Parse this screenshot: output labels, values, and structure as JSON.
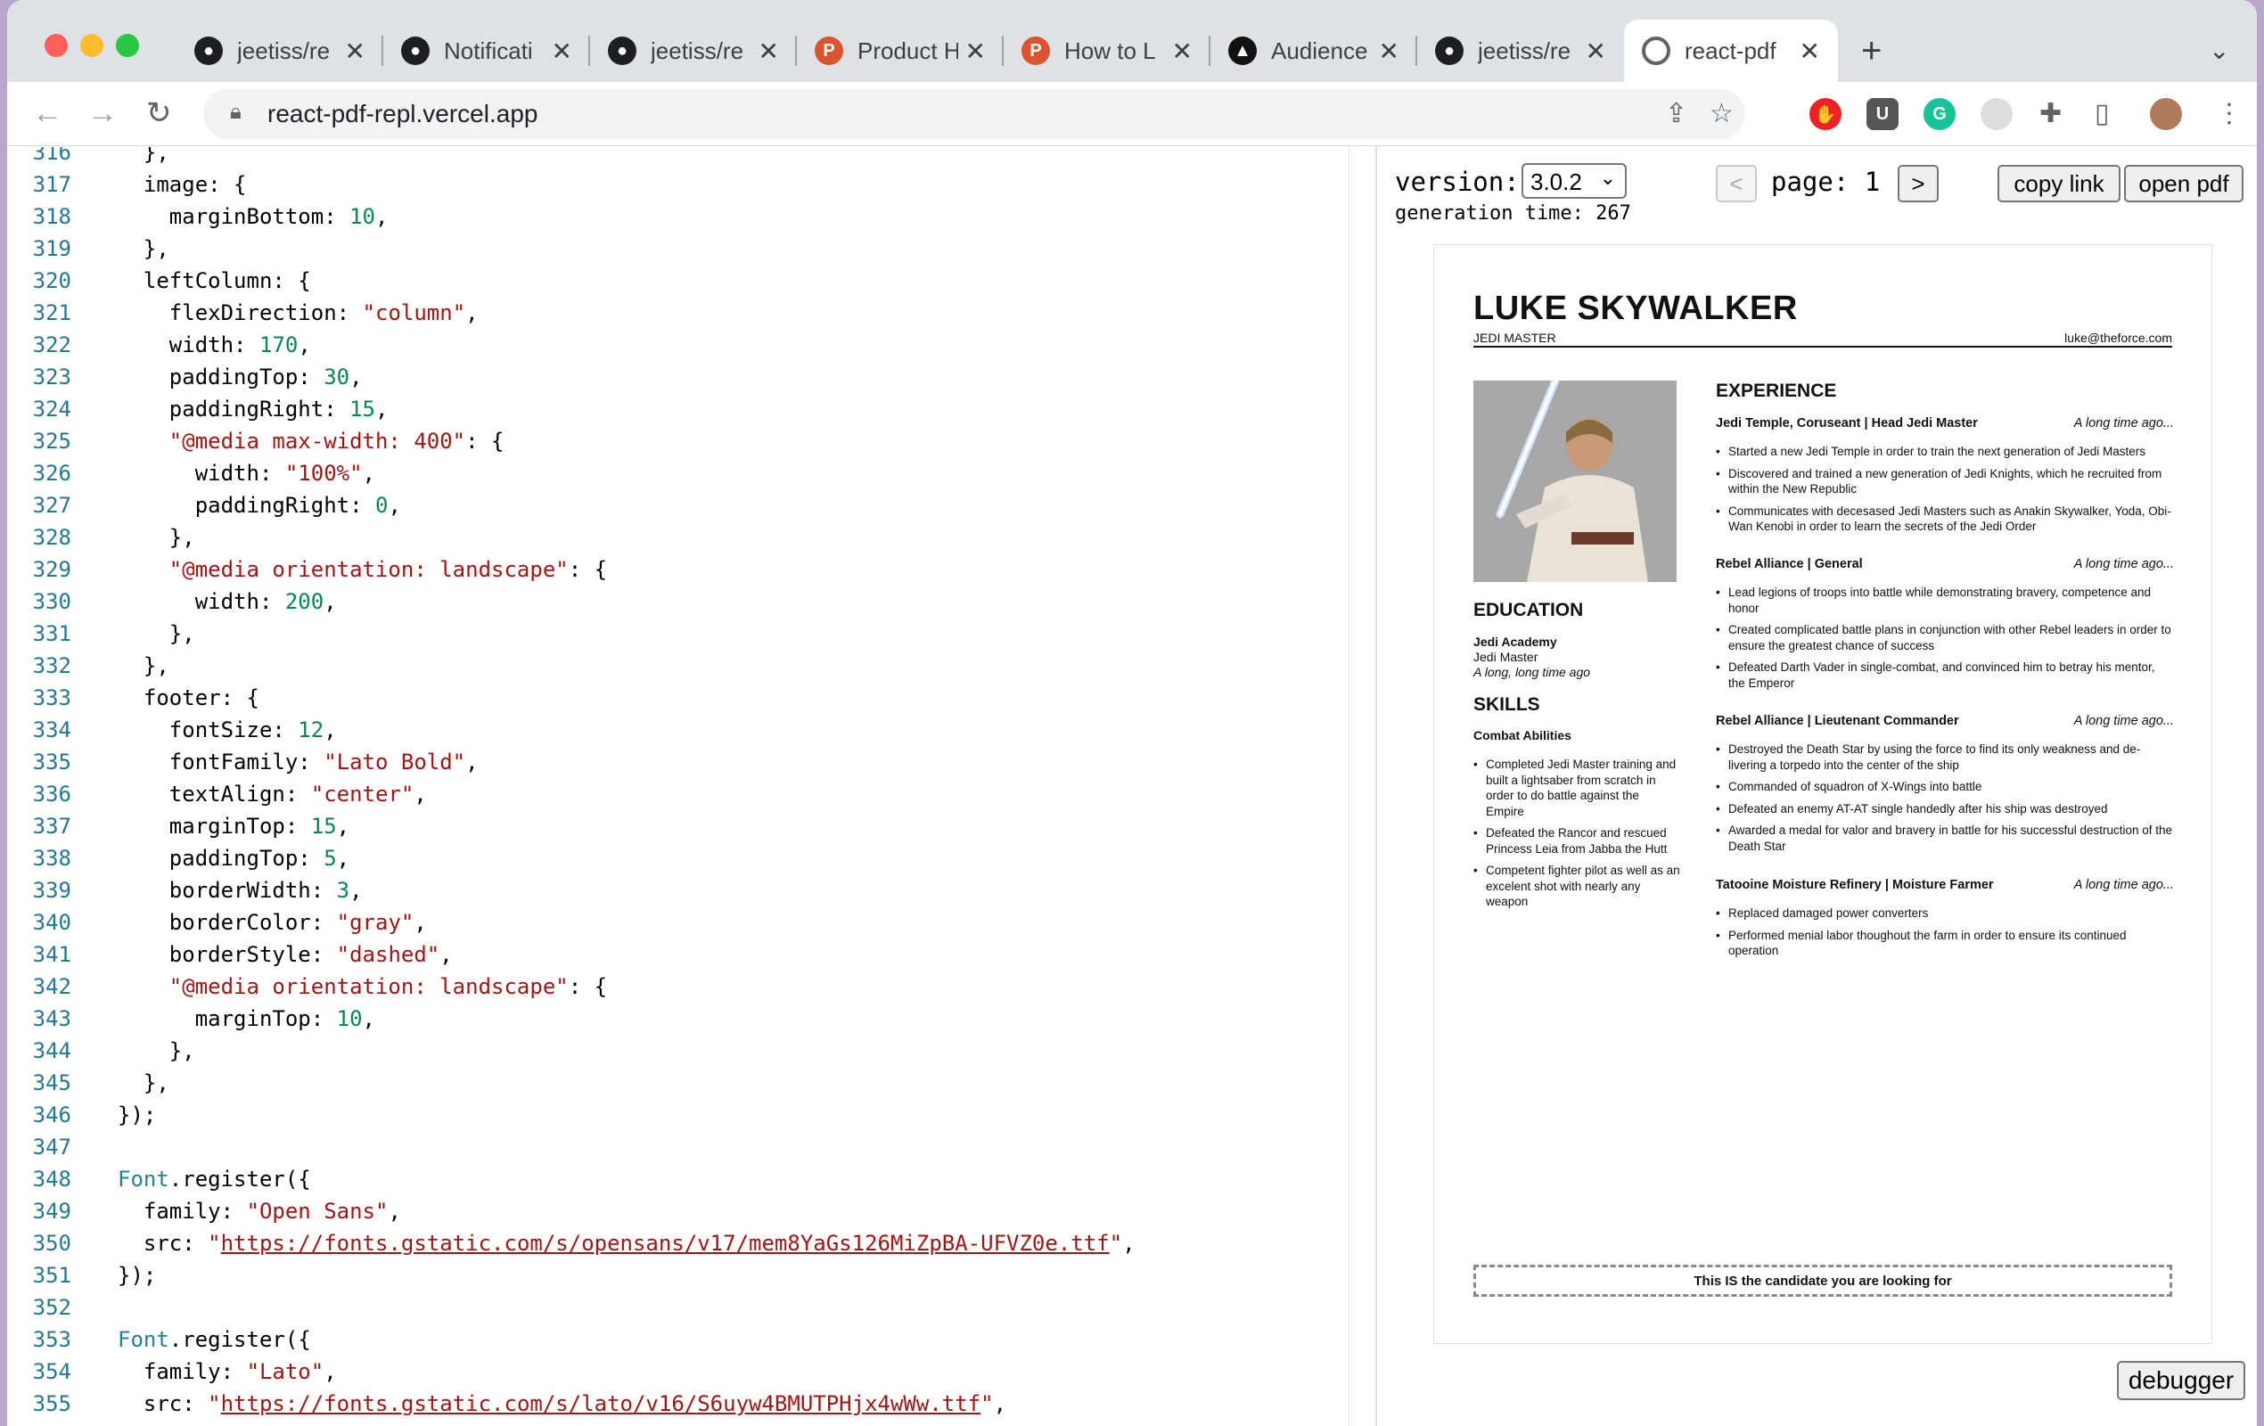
{
  "tabs": [
    {
      "label": "jeetiss/re",
      "icon": "github-icon"
    },
    {
      "label": "Notificati",
      "icon": "github-icon"
    },
    {
      "label": "jeetiss/re",
      "icon": "github-icon"
    },
    {
      "label": "Product H",
      "icon": "producthunt-icon"
    },
    {
      "label": "How to L",
      "icon": "producthunt-icon"
    },
    {
      "label": "Audience",
      "icon": "triangle-icon"
    },
    {
      "label": "jeetiss/re",
      "icon": "github-icon"
    },
    {
      "label": "react-pdf",
      "icon": "loading-icon"
    }
  ],
  "address_bar": {
    "url": "react-pdf-repl.vercel.app"
  },
  "editor": {
    "lines": [
      {
        "n": "316",
        "text": "  },"
      },
      {
        "n": "317",
        "text": "  image: {"
      },
      {
        "n": "318",
        "text": "    marginBottom: 10,"
      },
      {
        "n": "319",
        "text": "  },"
      },
      {
        "n": "320",
        "text": "  leftColumn: {"
      },
      {
        "n": "321",
        "text": "    flexDirection: \"column\","
      },
      {
        "n": "322",
        "text": "    width: 170,"
      },
      {
        "n": "323",
        "text": "    paddingTop: 30,"
      },
      {
        "n": "324",
        "text": "    paddingRight: 15,"
      },
      {
        "n": "325",
        "text": "    \"@media max-width: 400\": {"
      },
      {
        "n": "326",
        "text": "      width: \"100%\","
      },
      {
        "n": "327",
        "text": "      paddingRight: 0,"
      },
      {
        "n": "328",
        "text": "    },"
      },
      {
        "n": "329",
        "text": "    \"@media orientation: landscape\": {"
      },
      {
        "n": "330",
        "text": "      width: 200,"
      },
      {
        "n": "331",
        "text": "    },"
      },
      {
        "n": "332",
        "text": "  },"
      },
      {
        "n": "333",
        "text": "  footer: {"
      },
      {
        "n": "334",
        "text": "    fontSize: 12,"
      },
      {
        "n": "335",
        "text": "    fontFamily: \"Lato Bold\","
      },
      {
        "n": "336",
        "text": "    textAlign: \"center\","
      },
      {
        "n": "337",
        "text": "    marginTop: 15,"
      },
      {
        "n": "338",
        "text": "    paddingTop: 5,"
      },
      {
        "n": "339",
        "text": "    borderWidth: 3,"
      },
      {
        "n": "340",
        "text": "    borderColor: \"gray\","
      },
      {
        "n": "341",
        "text": "    borderStyle: \"dashed\","
      },
      {
        "n": "342",
        "text": "    \"@media orientation: landscape\": {"
      },
      {
        "n": "343",
        "text": "      marginTop: 10,"
      },
      {
        "n": "344",
        "text": "    },"
      },
      {
        "n": "345",
        "text": "  },"
      },
      {
        "n": "346",
        "text": "});"
      },
      {
        "n": "347",
        "text": ""
      },
      {
        "n": "348",
        "text": "Font.register({"
      },
      {
        "n": "349",
        "text": "  family: \"Open Sans\","
      },
      {
        "n": "350",
        "text": "  src: \"https://fonts.gstatic.com/s/opensans/v17/mem8YaGs126MiZpBA-UFVZ0e.ttf\","
      },
      {
        "n": "351",
        "text": "});"
      },
      {
        "n": "352",
        "text": ""
      },
      {
        "n": "353",
        "text": "Font.register({"
      },
      {
        "n": "354",
        "text": "  family: \"Lato\","
      },
      {
        "n": "355",
        "text": "  src: \"https://fonts.gstatic.com/s/lato/v16/S6uyw4BMUTPHjx4wWw.ttf\","
      }
    ]
  },
  "preview": {
    "version_label": "version:",
    "version_value": "3.0.2",
    "generation_time_label": "generation time: 267",
    "prev_label": "<",
    "page_label": "page: 1",
    "next_label": ">",
    "copy_link_label": "copy link",
    "open_pdf_label": "open pdf",
    "debugger_label": "debugger"
  },
  "resume": {
    "name": "LUKE SKYWALKER",
    "title": "JEDI MASTER",
    "email": "luke@theforce.com",
    "education_heading": "EDUCATION",
    "education_school": "Jedi Academy",
    "education_degree": "Jedi Master",
    "education_date": "A long, long time ago",
    "skills_heading": "SKILLS",
    "skills_subheading": "Combat Abilities",
    "skills": [
      "Completed Jedi Master training and built a lightsaber from scratch in order to do battle against the Empire",
      "Defeated the Rancor and rescued Princess Leia from Jabba the Hutt",
      "Competent fighter pilot as well as an excelent shot with nearly any weapon"
    ],
    "experience_heading": "EXPERIENCE",
    "jobs": [
      {
        "title": "Jedi Temple, Coruseant | Head Jedi Master",
        "date": "A long time ago...",
        "bullets": [
          "Started a new Jedi Temple in order to train the next generation of Jedi Masters",
          "Discovered and trained a new generation of Jedi Knights, which he recruited from within the New Republic",
          "Communicates with decesased Jedi Masters such as Anakin Skywalker, Yoda, Obi-Wan Kenobi in order to learn the secrets of the Jedi Order"
        ]
      },
      {
        "title": "Rebel Alliance | General",
        "date": "A long time ago...",
        "bullets": [
          "Lead legions of troops into battle while demonstrating bravery, competence and honor",
          "Created complicated battle plans in conjunction with other Rebel leaders in order to ensure the greatest chance of success",
          "Defeated Darth Vader in single-combat, and convinced him to betray his mentor, the Emperor"
        ]
      },
      {
        "title": "Rebel Alliance | Lieutenant Commander",
        "date": "A long time ago...",
        "bullets": [
          "Destroyed the Death Star by using the force to find its only weakness and de-livering a torpedo into the center of the ship",
          "Commanded of squadron of X-Wings into battle",
          "Defeated an enemy AT-AT single handedly after his ship was destroyed",
          "Awarded a medal for valor and bravery in battle for his successful destruction of the Death Star"
        ]
      },
      {
        "title": "Tatooine Moisture Refinery | Moisture Farmer",
        "date": "A long time ago...",
        "bullets": [
          "Replaced damaged power converters",
          "Performed menial labor thoughout the farm in order to ensure its continued operation"
        ]
      }
    ],
    "footer": "This IS the candidate you are looking for"
  }
}
